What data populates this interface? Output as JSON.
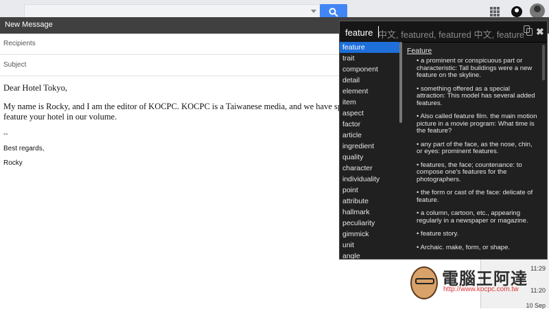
{
  "compose": {
    "title": "New Message",
    "recipients_placeholder": "Recipients",
    "subject_placeholder": "Subject",
    "body_lines": [
      "Dear Hotel Tokyo,",
      "My name is Rocky, and I am the editor of KOCPC.   KOCPC is a Taiwanese media, and we have special",
      "feature your hotel in our volume."
    ],
    "signature_separator": "--",
    "closing": "Best regards,",
    "sender": "Rocky"
  },
  "dictionary": {
    "query": "feature",
    "suggestions": "中文,  featured,  featured 中文,  feature",
    "synonyms": [
      "feature",
      "trait",
      "component",
      "detail",
      "element",
      "item",
      "aspect",
      "factor",
      "article",
      "ingredient",
      "quality",
      "character",
      "individuality",
      "point",
      "attribute",
      "hallmark",
      "peculiarity",
      "gimmick",
      "unit",
      "angle"
    ],
    "selected_synonym": "feature",
    "definition_title": "Feature",
    "definitions": [
      "• a prominent or conspicuous part or characteristic: Tall buildings were a new feature on the skyline.",
      "• something offered as a special attraction: This model has several added features.",
      "• Also called feature film. the main motion picture in a movie program: What time is the feature?",
      "• any part of the face, as the nose, chin, or eyes: prominent features.",
      "• features, the face; countenance: to compose one's features for the photographers.",
      "• the form or cast of the face: delicate of feature.",
      "• a column, cartoon, etc., appearing regularly in a newspaper or magazine.",
      "• feature story.",
      "• Archaic. make, form, or shape."
    ],
    "close_symbol": "✖"
  },
  "side_panel": {
    "times": [
      "11:29",
      "11:20",
      "10 Sep"
    ]
  },
  "watermark": {
    "brand": "電腦王阿達",
    "url": "http://www.kocpc.com.tw"
  },
  "colors": {
    "selection": "#1e6fd9",
    "popup_bg": "#202020",
    "compose_header": "#404040",
    "search_button": "#4285f4"
  }
}
